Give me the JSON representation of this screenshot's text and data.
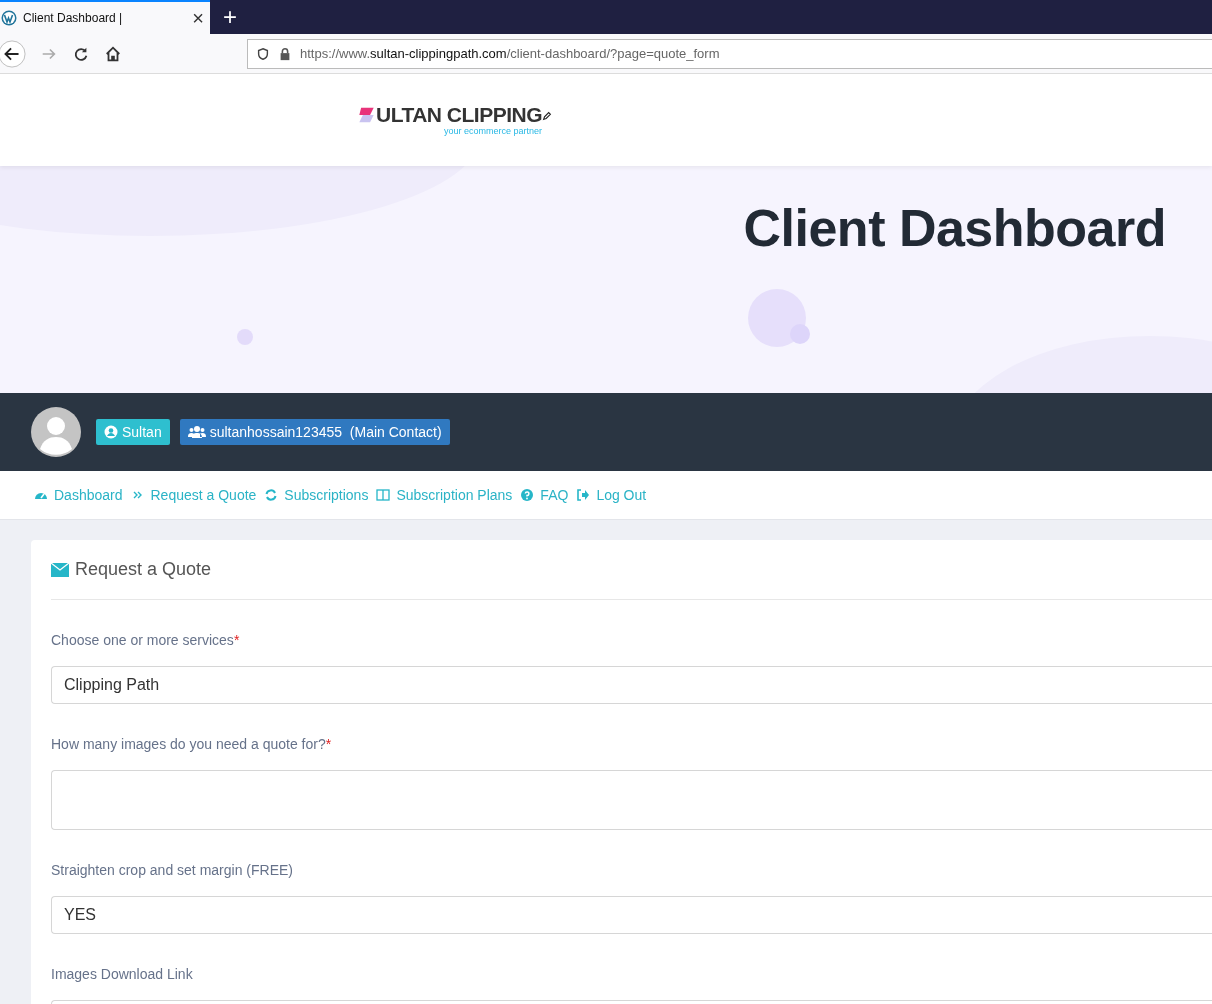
{
  "browser": {
    "tab_title": "Client Dashboard |",
    "new_tab": "+",
    "close": "×",
    "url_prefix": "https://www.",
    "url_host": "sultan-clippingpath.com",
    "url_path": "/client-dashboard/?page=quote_form"
  },
  "logo": {
    "name": "ULTAN CLIPPING",
    "tagline": "your ecommerce partner"
  },
  "hero": {
    "title": "Client Dashboard"
  },
  "user_bar": {
    "name": "Sultan",
    "contact": "sultanhossain123455  (Main Contact)"
  },
  "nav": [
    {
      "label": "Dashboard"
    },
    {
      "label": "Request a Quote"
    },
    {
      "label": "Subscriptions"
    },
    {
      "label": "Subscription Plans"
    },
    {
      "label": "FAQ"
    },
    {
      "label": "Log Out"
    }
  ],
  "form": {
    "title": "Request a Quote",
    "fields": [
      {
        "kind": "select",
        "label": "Choose one or more services",
        "required_mark": "*",
        "value": "Clipping Path"
      },
      {
        "kind": "textarea",
        "label": "How many images do you need a quote for?",
        "required_mark": "*"
      },
      {
        "kind": "select",
        "label": "Straighten crop and set margin (FREE)",
        "value": "YES"
      },
      {
        "kind": "input",
        "label": "Images Download Link"
      }
    ]
  }
}
